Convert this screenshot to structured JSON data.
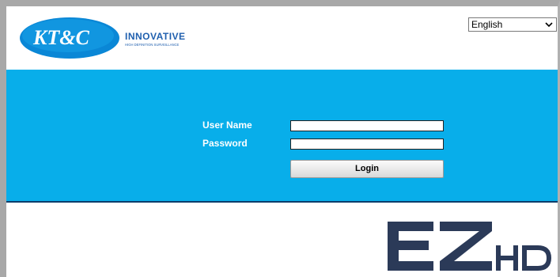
{
  "brand": {
    "logo_text": "KT&C",
    "company": "INNOVATIVE",
    "tagline": "HIGH DEFINITION SURVEILLANCE"
  },
  "language": {
    "selected": "English"
  },
  "login_form": {
    "username_label": "User Name",
    "password_label": "Password",
    "username_value": "",
    "password_value": "",
    "login_label": "Login"
  },
  "product_logo": {
    "text_main": "EZ",
    "text_sub": "HD"
  },
  "colors": {
    "band": "#08aeea",
    "band_border": "#0b3d6b",
    "logo_blue": "#1f5fae",
    "ez_navy": "#2b3a58"
  },
  "icons": {
    "dropdown": "chevron-down-icon"
  }
}
